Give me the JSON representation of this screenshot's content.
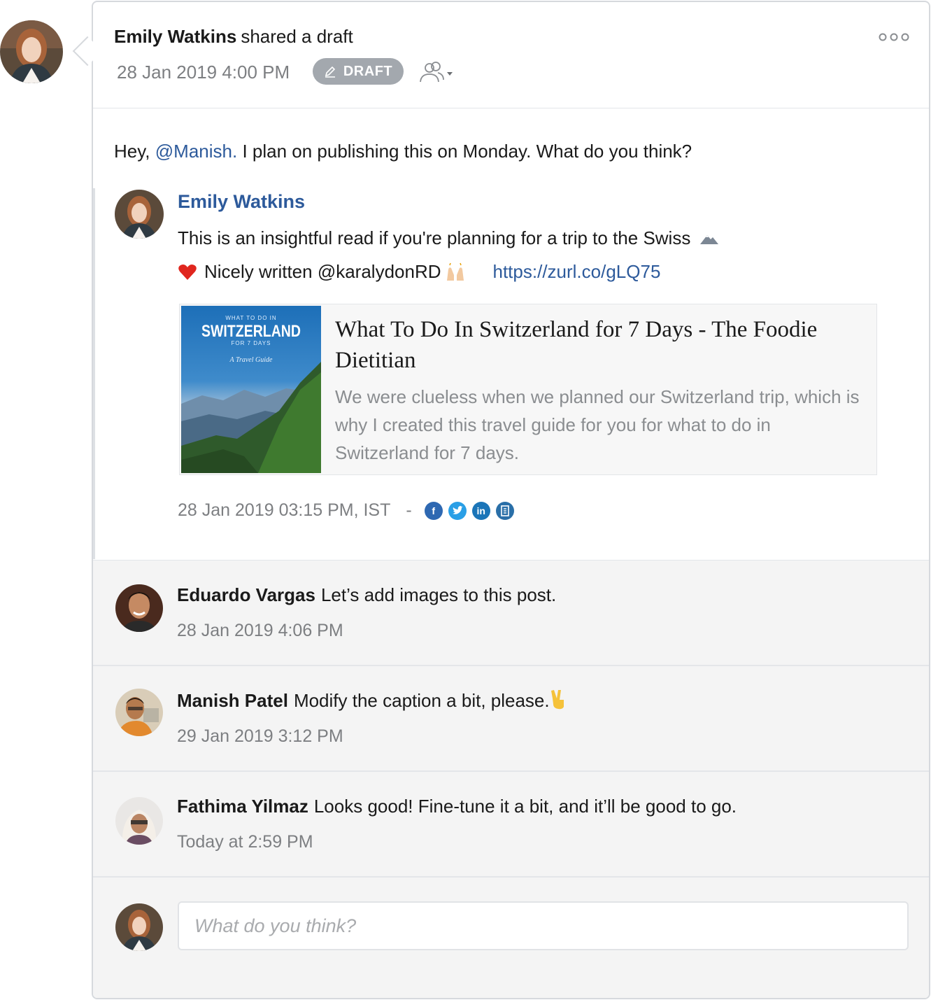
{
  "post": {
    "author": "Emily Watkins",
    "action": "shared a draft",
    "timestamp": "28 Jan 2019 4:00 PM",
    "status_badge": "DRAFT",
    "message_prefix": "Hey,",
    "mention": "@Manish.",
    "message_suffix": "I plan on publishing this on Monday. What do you think?"
  },
  "quoted_post": {
    "author": "Emily Watkins",
    "line1": "This is an insightful read if you're planning for a trip to the Swiss",
    "line2": "Nicely written @karalydonRD",
    "link": "https://zurl.co/gLQ75",
    "preview": {
      "image_title_small": "WHAT TO DO IN",
      "image_title": "SWITZERLAND",
      "image_subtitle": "FOR 7 DAYS",
      "image_caption": "A Travel Guide",
      "title": "What To Do In Switzerland for 7 Days - The Foodie Dietitian",
      "description": "We were clueless when we planned our Switzerland trip, which is why I created this travel guide for you for what to do in Switzerland for 7 days."
    },
    "scheduled": "28 Jan 2019 03:15 PM, IST",
    "separator": "-",
    "channels": [
      "facebook-icon",
      "twitter-icon",
      "linkedin-icon",
      "google-business-icon"
    ]
  },
  "comments": [
    {
      "author": "Eduardo Vargas",
      "text": "Let’s add images to this post.",
      "time": "28 Jan 2019 4:06 PM"
    },
    {
      "author": "Manish Patel",
      "text": "Modify the caption a bit, please.",
      "time": "29 Jan 2019 3:12 PM"
    },
    {
      "author": "Fathima Yilmaz",
      "text": "Looks good! Fine-tune it a bit, and it’ll be good to go.",
      "time": "Today at 2:59 PM"
    }
  ],
  "reply": {
    "placeholder": "What do you think?"
  },
  "colors": {
    "link": "#2d5a9b",
    "badge": "#a3a8ae",
    "muted": "#7d7f82",
    "comment_bg": "#f4f4f4"
  }
}
